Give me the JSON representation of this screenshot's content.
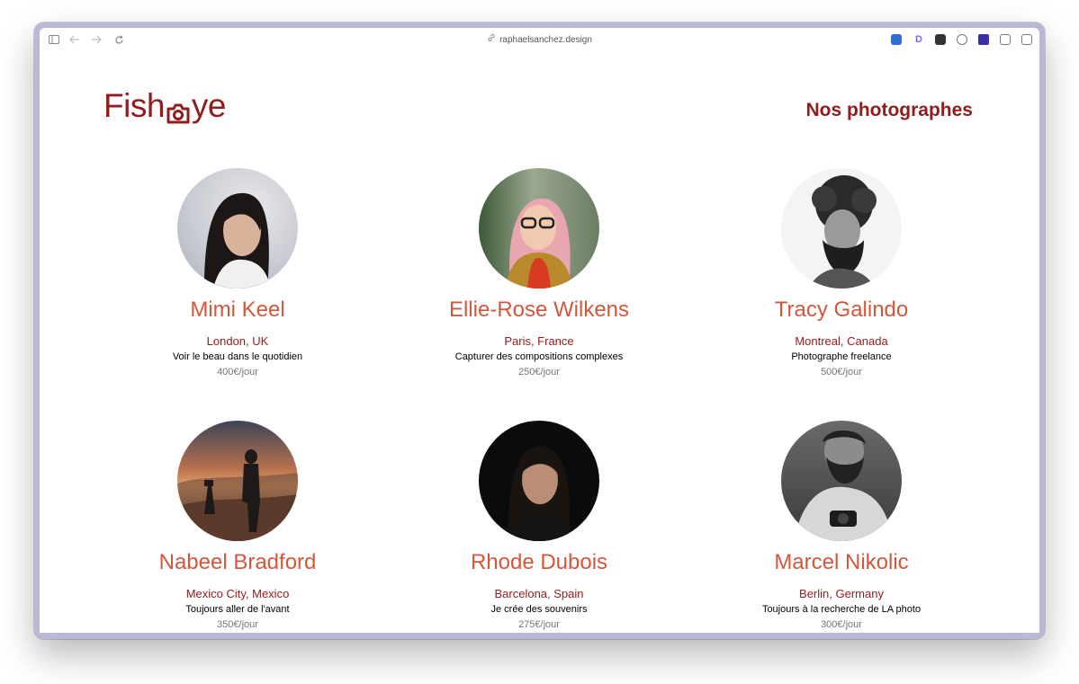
{
  "browser": {
    "url": "raphaelsanchez.design"
  },
  "header": {
    "logo_part1": "Fish",
    "logo_part2": "ye",
    "title": "Nos photographes"
  },
  "photographers": [
    {
      "name": "Mimi Keel",
      "location": "London, UK",
      "tagline": "Voir le beau dans le quotidien",
      "price": "400€/jour"
    },
    {
      "name": "Ellie-Rose Wilkens",
      "location": "Paris, France",
      "tagline": "Capturer des compositions complexes",
      "price": "250€/jour"
    },
    {
      "name": "Tracy Galindo",
      "location": "Montreal, Canada",
      "tagline": "Photographe freelance",
      "price": "500€/jour"
    },
    {
      "name": "Nabeel Bradford",
      "location": "Mexico City, Mexico",
      "tagline": "Toujours aller de l'avant",
      "price": "350€/jour"
    },
    {
      "name": "Rhode Dubois",
      "location": "Barcelona, Spain",
      "tagline": "Je crée des souvenirs",
      "price": "275€/jour"
    },
    {
      "name": "Marcel Nikolic",
      "location": "Berlin, Germany",
      "tagline": "Toujours à la recherche de LA photo",
      "price": "300€/jour"
    }
  ],
  "colors": {
    "brand": "#901c1c",
    "name_accent": "#d3573c",
    "price_gray": "#757575"
  }
}
